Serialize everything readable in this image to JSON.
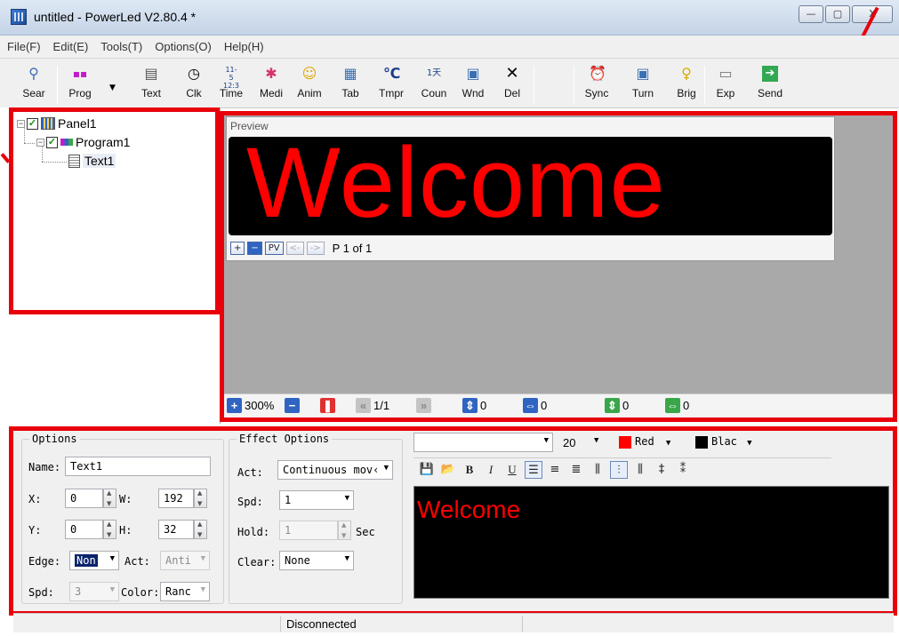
{
  "window": {
    "title": "untitled - PowerLed V2.80.4 *",
    "controls": [
      "—",
      "▢",
      "X"
    ]
  },
  "menu": [
    "File(F)",
    "Edit(E)",
    "Tools(T)",
    "Options(O)",
    "Help(H)"
  ],
  "toolbar": [
    {
      "label": "Sear",
      "icon": "search-icon"
    },
    {
      "label": "Prog",
      "icon": "program-icon"
    },
    {
      "label": "Text",
      "icon": "text-icon"
    },
    {
      "label": "Clk",
      "icon": "clock-icon"
    },
    {
      "label": "Time",
      "icon": "time-icon"
    },
    {
      "label": "Medi",
      "icon": "media-icon"
    },
    {
      "label": "Anim",
      "icon": "animation-icon"
    },
    {
      "label": "Tab",
      "icon": "table-icon"
    },
    {
      "label": "Tmpr",
      "icon": "temperature-icon"
    },
    {
      "label": "Coun",
      "icon": "counter-icon"
    },
    {
      "label": "Wnd",
      "icon": "window-icon"
    },
    {
      "label": "Del",
      "icon": "delete-icon"
    },
    {
      "label": "Sync",
      "icon": "sync-icon"
    },
    {
      "label": "Turn",
      "icon": "turn-icon"
    },
    {
      "label": "Brig",
      "icon": "brightness-icon"
    },
    {
      "label": "Exp",
      "icon": "export-icon"
    },
    {
      "label": "Send",
      "icon": "send-icon"
    }
  ],
  "tree": {
    "panel": "Panel1",
    "program": "Program1",
    "text": "Text1"
  },
  "preview": {
    "caption": "Preview",
    "led_text": "Welcome",
    "controls": [
      "+",
      "−",
      "PV",
      "<-",
      "->"
    ],
    "page": "P 1 of 1"
  },
  "zoombar": {
    "zoom": "300%",
    "page": "1/1",
    "v1": "0",
    "v2": "0",
    "v3": "0",
    "v4": "0"
  },
  "options": {
    "title": "Options",
    "name_label": "Name:",
    "name_value": "Text1",
    "x_label": "X:",
    "x_value": "0",
    "w_label": "W:",
    "w_value": "192",
    "y_label": "Y:",
    "y_value": "0",
    "h_label": "H:",
    "h_value": "32",
    "edge_label": "Edge:",
    "edge_value": "Non",
    "act_label": "Act:",
    "act_value": "Anti",
    "spd_label": "Spd:",
    "spd_value": "3",
    "color_label": "Color:",
    "color_value": "Ranc"
  },
  "effect": {
    "title": "Effect Options",
    "act_label": "Act:",
    "act_value": "Continuous mov‹",
    "spd_label": "Spd:",
    "spd_value": "1",
    "hold_label": "Hold:",
    "hold_value": "1",
    "hold_unit": "Sec",
    "clear_label": "Clear:",
    "clear_value": "None"
  },
  "format": {
    "font_size": "20",
    "fg_color": "Red",
    "fg_hex": "#ff0000",
    "bg_color": "Blac",
    "bg_hex": "#000000"
  },
  "editor": {
    "text": "Welcome"
  },
  "status": {
    "connection": "Disconnected"
  }
}
